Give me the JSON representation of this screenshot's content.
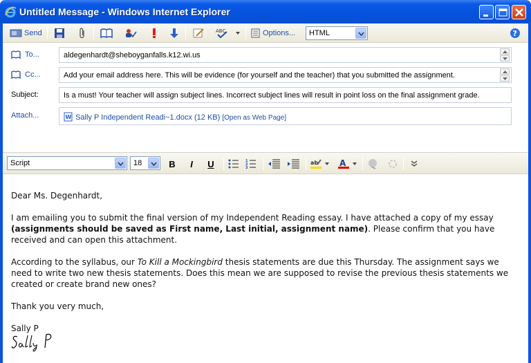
{
  "window": {
    "title": "Untitled Message - Windows Internet Explorer"
  },
  "toolbar": {
    "send_label": "Send",
    "options_label": "Options...",
    "format_value": "HTML"
  },
  "header": {
    "to_label": "To...",
    "to_value": "aldegenhardt@sheboyganfalls.k12.wi.us",
    "cc_label": "Cc...",
    "cc_value": "Add your email address here. This will be evidence (for yourself and the teacher) that you submitted the assignment.",
    "subject_label": "Subject:",
    "subject_value": "Is a must! Your teacher will assign subject lines. Incorrect subject lines will result in point loss on the final assignment grade.",
    "attach_label": "Attach...",
    "attachment_name": "Sally P Independent Readi~1.docx (12 KB)",
    "attachment_open": "[Open as Web Page]"
  },
  "format_toolbar": {
    "font_value": "Script",
    "size_value": "18",
    "bold": "B",
    "italic": "I",
    "underline": "U"
  },
  "message": {
    "greeting": "Dear Ms. Degenhardt,",
    "p1_start": "I am emailing you to submit the final version of my Independent Reading essay. I have attached a copy of my essay ",
    "p1_bold": "(assignments should be saved as First name, Last initial, assignment name)",
    "p1_end": ". Please confirm that you have received and can open this attachment.",
    "p2_start": "According to the syllabus, our ",
    "p2_italic": "To Kill a Mockingbird",
    "p2_end": " thesis statements are due this Thursday. The assignment says we need to write two new thesis statements. Does this mean we are supposed to revise the previous thesis statements we created or create brand new ones?",
    "closing": "Thank you very much,",
    "name": "Sally P",
    "signature_text": "Sally P"
  },
  "colors": {
    "titlebar": "#0553dd",
    "link": "#1f4ea8",
    "highlight": "#ffd800",
    "font_color": "#e00000"
  }
}
